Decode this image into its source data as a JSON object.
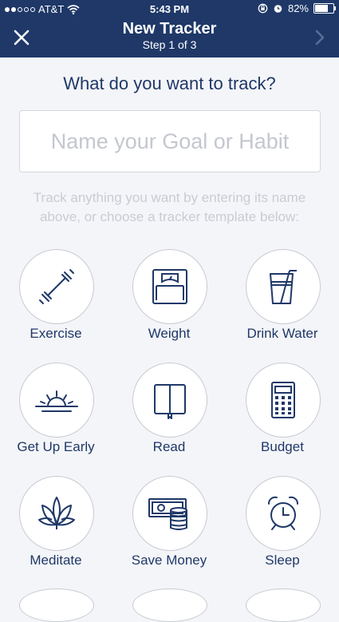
{
  "status_bar": {
    "carrier": "AT&T",
    "time": "5:43 PM",
    "battery_percent": "82%",
    "battery_level": 0.82,
    "signal_dots": [
      true,
      true,
      false,
      false,
      false
    ]
  },
  "header": {
    "title": "New Tracker",
    "step": "Step 1 of 3",
    "close_icon": "close-icon",
    "next_icon": "chevron-right-icon"
  },
  "main": {
    "question": "What do you want to track?",
    "input_placeholder": "Name your Goal or Habit",
    "input_value": "",
    "hint": "Track anything you want by entering its name above, or choose a tracker template below:"
  },
  "templates": [
    {
      "label": "Exercise",
      "icon": "dumbbell-icon"
    },
    {
      "label": "Weight",
      "icon": "scale-icon"
    },
    {
      "label": "Drink Water",
      "icon": "water-glass-icon"
    },
    {
      "label": "Get Up Early",
      "icon": "sunrise-icon"
    },
    {
      "label": "Read",
      "icon": "book-icon"
    },
    {
      "label": "Budget",
      "icon": "calculator-icon"
    },
    {
      "label": "Meditate",
      "icon": "lotus-icon"
    },
    {
      "label": "Save Money",
      "icon": "money-icon"
    },
    {
      "label": "Sleep",
      "icon": "alarm-clock-icon"
    }
  ],
  "colors": {
    "header": "#1f3868",
    "background": "#f4f5f8",
    "text": "#1f3868",
    "muted": "#c9ccd3"
  }
}
